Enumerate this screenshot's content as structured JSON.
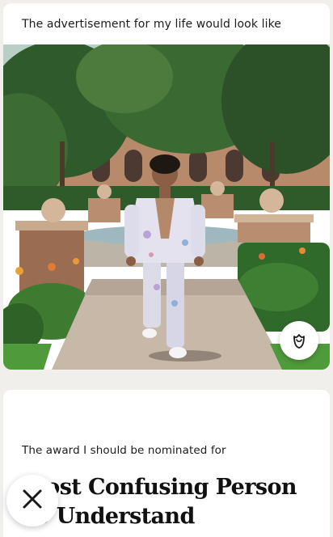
{
  "photo_prompt": {
    "label": "The advertisement for my life would look like",
    "image_description": "photo",
    "like_icon": "rose-icon"
  },
  "text_prompt": {
    "label": "The award I should be nominated for",
    "answer": "Most Confusing Person To Understand"
  },
  "actions": {
    "dismiss_icon": "close-x-icon"
  },
  "colors": {
    "background": "#f1efec",
    "card": "#ffffff",
    "text": "#1c1c1c"
  }
}
